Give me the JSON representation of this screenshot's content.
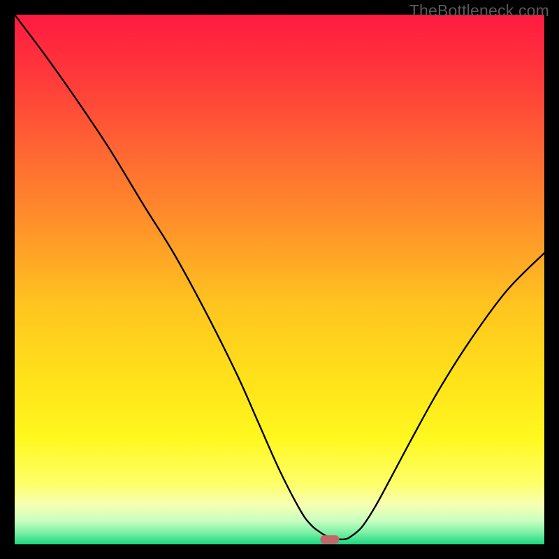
{
  "watermark": {
    "text": "TheBottleneck.com"
  },
  "chart_data": {
    "type": "line",
    "title": "",
    "xlabel": "",
    "ylabel": "",
    "xlim": [
      0,
      100
    ],
    "ylim": [
      0,
      100
    ],
    "legend": false,
    "series": [
      {
        "name": "bottleneck-curve",
        "x": [
          0,
          6,
          12,
          18,
          24.5,
          30,
          36,
          42,
          46,
          50,
          54,
          56,
          57.5,
          59,
          61,
          62.5,
          63.5,
          65.5,
          68,
          71,
          75,
          80,
          86,
          93,
          100
        ],
        "y": [
          100,
          92,
          83.5,
          74.5,
          63.8,
          55,
          44,
          32,
          23,
          14,
          6.3,
          3.6,
          2.4,
          1.5,
          1.0,
          1.0,
          1.5,
          3.2,
          7,
          12.5,
          20,
          29,
          38.5,
          48,
          55
        ]
      }
    ],
    "marker": {
      "shape": "rounded-pill",
      "x": 59.5,
      "y": 0.9,
      "width_ratio": 0.036,
      "height_ratio": 0.016,
      "color": "#c56669"
    },
    "background_gradient": {
      "type": "vertical",
      "stops": [
        {
          "pos": 0.0,
          "color": "#ff1a41"
        },
        {
          "pos": 0.12,
          "color": "#ff3a3a"
        },
        {
          "pos": 0.25,
          "color": "#ff6433"
        },
        {
          "pos": 0.38,
          "color": "#ff8c2b"
        },
        {
          "pos": 0.55,
          "color": "#ffc51f"
        },
        {
          "pos": 0.7,
          "color": "#ffe41a"
        },
        {
          "pos": 0.8,
          "color": "#fff81f"
        },
        {
          "pos": 0.885,
          "color": "#feff68"
        },
        {
          "pos": 0.925,
          "color": "#f6ffb3"
        },
        {
          "pos": 0.955,
          "color": "#c9ffc0"
        },
        {
          "pos": 0.978,
          "color": "#7cf0a6"
        },
        {
          "pos": 1.0,
          "color": "#1bd880"
        }
      ]
    }
  }
}
